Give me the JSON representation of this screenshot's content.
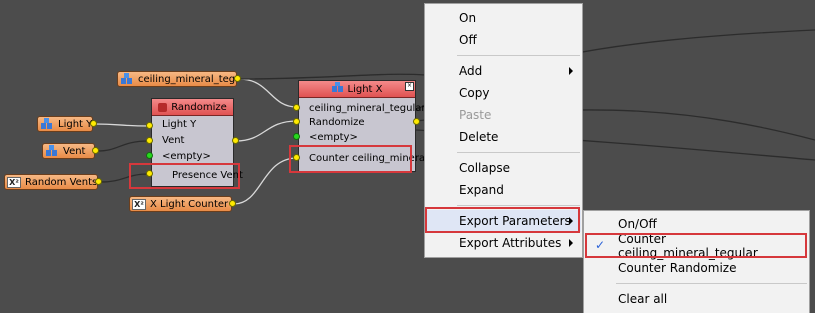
{
  "colors": {
    "canvas": "#4c4c4c",
    "highlight_border": "#d6383c",
    "node_header": "#e05252",
    "pill": "#e98b47",
    "port": "#ffea00",
    "port_empty": "#27d81e"
  },
  "pills": {
    "ceiling": {
      "label": "ceiling_mineral_teg",
      "icon": "blocks-icon"
    },
    "light_y": {
      "label": "Light Y",
      "icon": "blocks-icon"
    },
    "vent": {
      "label": "Vent",
      "icon": "blocks-icon"
    },
    "random_vents": {
      "label": "Random Vents",
      "icon": "x2-icon",
      "icon_text": "X²"
    },
    "x_light_counter": {
      "label": "X Light Counter",
      "icon": "x2-icon",
      "icon_text": "X²"
    }
  },
  "randomize_node": {
    "title": "Randomize",
    "ports": [
      "Light Y",
      "Vent",
      "<empty>",
      "Presence Vent"
    ]
  },
  "light_x_node": {
    "title": "Light X",
    "ports": [
      "ceiling_mineral_tegular",
      "Randomize",
      "<empty>",
      "Counter ceiling_mineral_"
    ]
  },
  "context_menu": {
    "items": [
      {
        "label": "On"
      },
      {
        "label": "Off"
      },
      {
        "label": "Add",
        "submenu": true
      },
      {
        "label": "Copy"
      },
      {
        "label": "Paste",
        "disabled": true
      },
      {
        "label": "Delete"
      },
      {
        "label": "Collapse"
      },
      {
        "label": "Expand"
      },
      {
        "label": "Export Parameters",
        "submenu": true
      },
      {
        "label": "Export Attributes",
        "submenu": true
      }
    ]
  },
  "submenu": {
    "items": [
      {
        "label": "On/Off"
      },
      {
        "label": "Counter ceiling_mineral_tegular",
        "checked": true
      },
      {
        "label": "Counter Randomize"
      },
      {
        "label": "Clear all"
      }
    ],
    "check_glyph": "✓"
  }
}
